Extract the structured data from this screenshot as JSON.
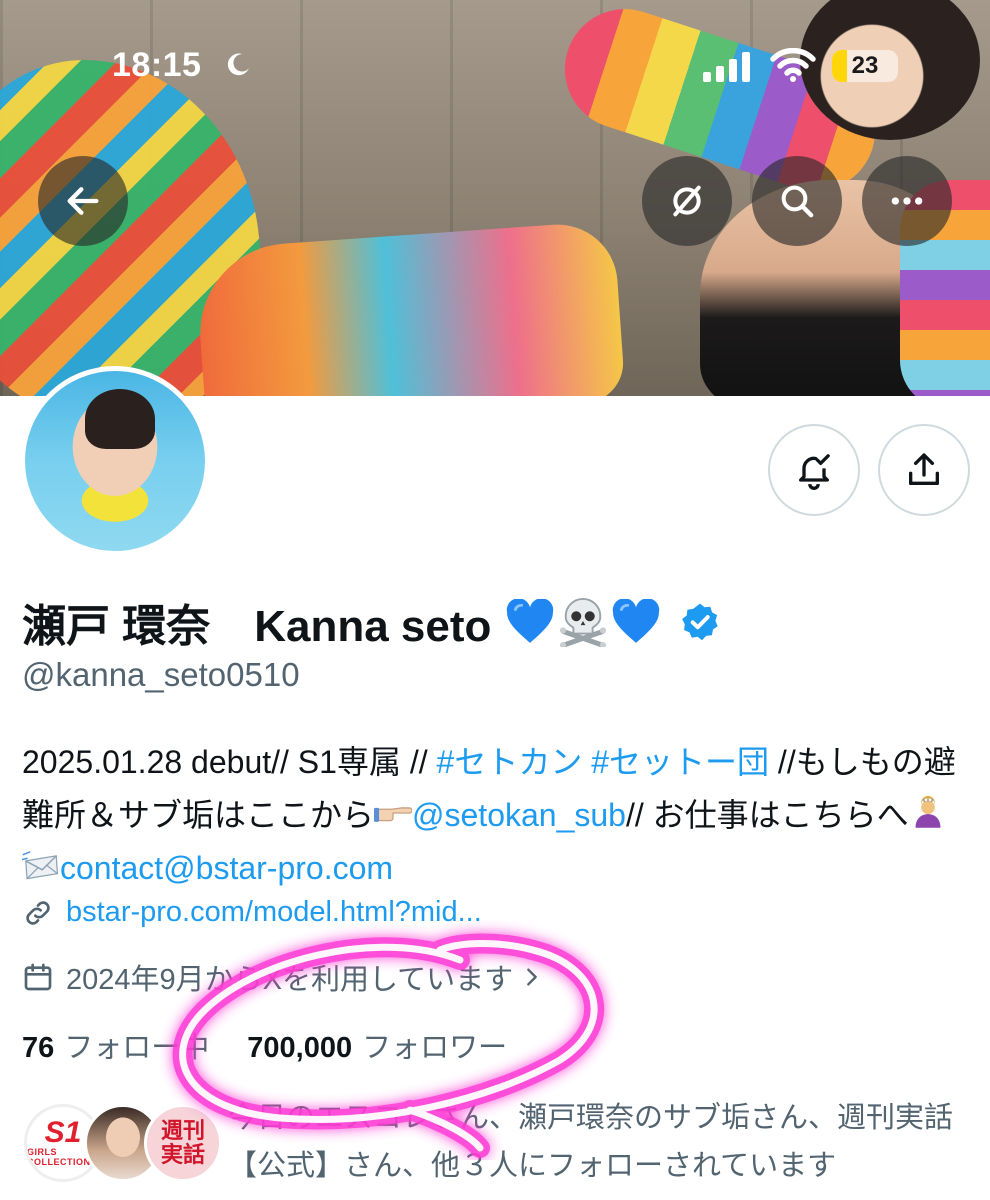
{
  "status_bar": {
    "time": "18:15",
    "battery": "23",
    "battery_level": 0.23,
    "focus_icon": "moon-icon",
    "signal_icon": "cellular-signal-icon",
    "wifi_icon": "wifi-icon"
  },
  "header": {
    "back_icon": "arrow-left-icon",
    "grok_icon": "grok-icon",
    "search_icon": "search-icon",
    "more_icon": "more-dots-icon"
  },
  "actions": {
    "notify_icon": "bell-check-icon",
    "share_icon": "share-icon"
  },
  "profile": {
    "display_name": "瀬戸 環奈　Kanna seto",
    "name_emojis": [
      "blue-heart",
      "skull-and-crossbones",
      "blue-heart"
    ],
    "verified": true,
    "handle": "@kanna_seto0510",
    "bio": {
      "part1": "2025.01.28 debut// S1専属 // ",
      "hashtag1": "#セトカン",
      "space": " ",
      "hashtag2": "#セットー団",
      "part2": " //もしもの避難所＆サブ垢はここから",
      "mention": "@setokan_sub",
      "part3": "// お仕事はこちらへ",
      "email": "contact@bstar-pro.com"
    },
    "website": "bstar-pro.com/model.html?mid...",
    "joined": "2024年9月からXを利用しています"
  },
  "stats": {
    "following_count": "76",
    "following_label": "フォロー中",
    "followers_count": "700,000",
    "followers_label": "フォロワー"
  },
  "followed_by": {
    "text": "今日のエスコレさん、瀬戸環奈のサブ垢さん、週刊実話【公式】さん、他３人にフォローされています",
    "avatar1_main": "S1",
    "avatar1_sub": "GIRLS COLLECTION",
    "avatar3_line1": "週刊",
    "avatar3_line2": "実話"
  },
  "colors": {
    "link": "#1d9bf0",
    "secondary_text": "#536471",
    "primary_text": "#0f1419",
    "annotation": "#ff3bd5"
  }
}
